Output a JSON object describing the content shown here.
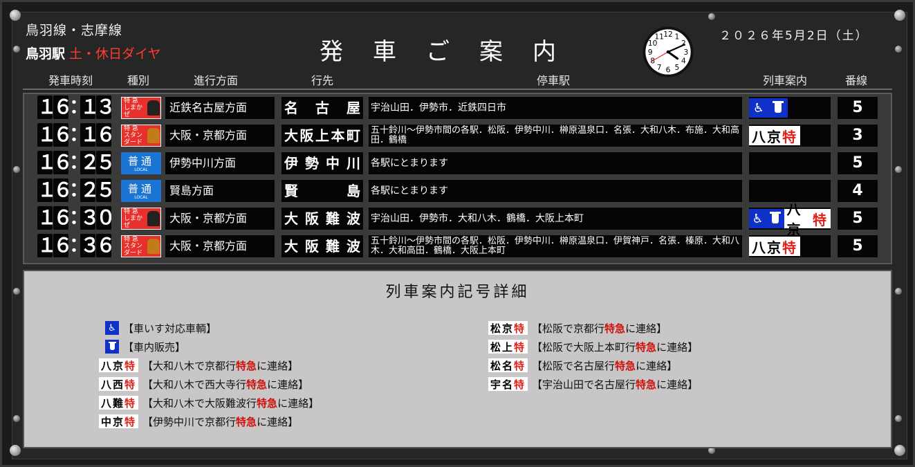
{
  "header": {
    "line_name": "鳥羽線・志摩線",
    "station": "鳥羽駅",
    "day_type": "土・休日ダイヤ",
    "title": "発車ご案内",
    "date": "２０２６年5月2日（土）",
    "clock": {
      "hour": 16,
      "minute": 11,
      "second": 40
    }
  },
  "columns": [
    "発車時刻",
    "種別",
    "進行方面",
    "行先",
    "停車駅",
    "列車案内",
    "番線"
  ],
  "trains": [
    {
      "time_h": "１６",
      "time_m": "１３",
      "type": "limited",
      "type_text": "特 急 しまかぜ",
      "direction": "近鉄名古屋方面",
      "destination": "名古屋",
      "stops": "宇治山田．伊勢市．近鉄四日市",
      "guide": [
        "wheelchair",
        "sales"
      ],
      "connect": "",
      "track": "5"
    },
    {
      "time_h": "１６",
      "time_m": "１６",
      "type": "limited",
      "type_text": "特 急 スタンダード",
      "direction": "大阪・京都方面",
      "destination": "大阪上本町",
      "stops": "五十鈴川〜伊勢市間の各駅．松阪．伊勢中川．榊原温泉口．名張．大和八木．布施．大和高田．鶴橋",
      "guide": [],
      "connect": "八京",
      "track": "3"
    },
    {
      "time_h": "１６",
      "time_m": "２５",
      "type": "local",
      "type_text": "普通",
      "type_sub": "LOCAL",
      "direction": "伊勢中川方面",
      "destination": "伊勢中川",
      "stops": "各駅にとまります",
      "guide": [],
      "connect": "",
      "track": "5"
    },
    {
      "time_h": "１６",
      "time_m": "２５",
      "type": "local",
      "type_text": "普通",
      "type_sub": "LOCAL",
      "direction": "賢島方面",
      "destination": "賢島",
      "stops": "各駅にとまります",
      "guide": [],
      "connect": "",
      "track": "4"
    },
    {
      "time_h": "１６",
      "time_m": "３０",
      "type": "limited",
      "type_text": "特 急 しまかぜ",
      "direction": "大阪・京都方面",
      "destination": "大阪難波",
      "stops": "宇治山田．伊勢市．大和八木．鶴橋．大阪上本町",
      "guide": [
        "wheelchair",
        "sales"
      ],
      "connect": "八京",
      "track": "5"
    },
    {
      "time_h": "１６",
      "time_m": "３６",
      "type": "limited",
      "type_text": "特 急 スタンダード",
      "direction": "大阪・京都方面",
      "destination": "大阪難波",
      "stops": "五十鈴川〜伊勢市間の各駅．松阪．伊勢中川．榊原温泉口．伊賀神戸．名張．榛原．大和八木．大和高田．鶴橋．大阪上本町",
      "guide": [],
      "connect": "八京",
      "track": "5"
    }
  ],
  "legend": {
    "title": "列車案内記号詳細",
    "tokkyu_mark": "特",
    "left": [
      {
        "icon": "wheelchair",
        "desc": "【車いす対応車輌】"
      },
      {
        "icon": "sales",
        "desc": "【車内販売】"
      },
      {
        "code": "八京",
        "desc_pre": "【大和八木で京都行",
        "desc_em": "特急",
        "desc_post": "に連絡】"
      },
      {
        "code": "八西",
        "desc_pre": "【大和八木で西大寺行",
        "desc_em": "特急",
        "desc_post": "に連絡】"
      },
      {
        "code": "八難",
        "desc_pre": "【大和八木で大阪難波行",
        "desc_em": "特急",
        "desc_post": "に連絡】"
      },
      {
        "code": "中京",
        "desc_pre": "【伊勢中川で京都行",
        "desc_em": "特急",
        "desc_post": "に連絡】"
      }
    ],
    "right": [
      {
        "code": "松京",
        "desc_pre": "【松阪で京都行",
        "desc_em": "特急",
        "desc_post": "に連絡】"
      },
      {
        "code": "松上",
        "desc_pre": "【松阪で大阪上本町行",
        "desc_em": "特急",
        "desc_post": "に連絡】"
      },
      {
        "code": "松名",
        "desc_pre": "【松阪で名古屋行",
        "desc_em": "特急",
        "desc_post": "に連絡】"
      },
      {
        "code": "宇名",
        "desc_pre": "【宇治山田で名古屋行",
        "desc_em": "特急",
        "desc_post": "に連絡】"
      }
    ]
  },
  "colors": {
    "red": "#ff3b30",
    "limited": "#e8302b",
    "local": "#1b73d2",
    "icon_blue": "#1031c8"
  }
}
